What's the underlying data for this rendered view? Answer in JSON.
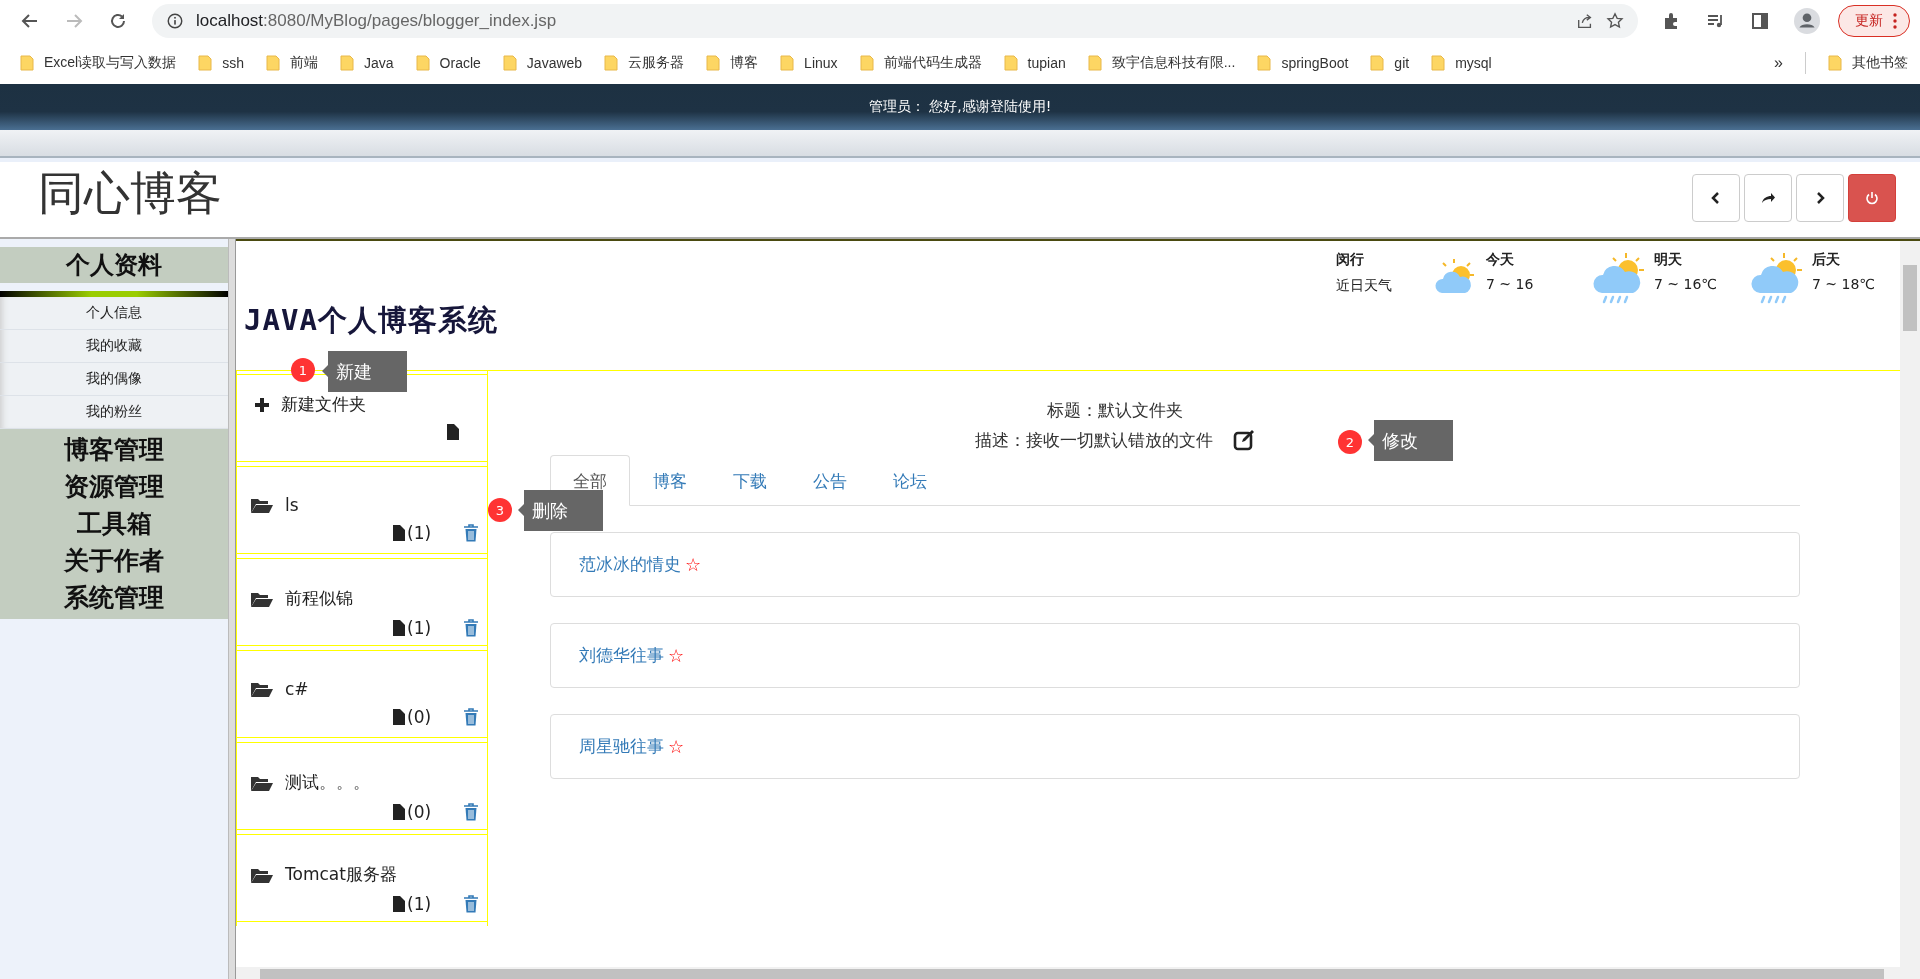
{
  "browser": {
    "url_host": "localhost",
    "url_rest": ":8080/MyBlog/pages/blogger_index.jsp",
    "update_button": "更新",
    "bookmarks": [
      "Excel读取与写入数据",
      "ssh",
      "前端",
      "Java",
      "Oracle",
      "Javaweb",
      "云服务器",
      "博客",
      "Linux",
      "前端代码生成器",
      "tupian",
      "致宇信息科技有限...",
      "springBoot",
      "git",
      "mysql"
    ],
    "more": "»",
    "other_bookmarks": "其他书签"
  },
  "banner": {
    "text": "管理员： 您好,感谢登陆使用!"
  },
  "header": {
    "title": "同心博客"
  },
  "sidebar": {
    "profile_title": "个人资料",
    "profile_items": [
      {
        "label": "个人信息"
      },
      {
        "label": "我的收藏"
      },
      {
        "label": "我的偶像"
      },
      {
        "label": "我的粉丝"
      }
    ],
    "sections": [
      {
        "label": "博客管理"
      },
      {
        "label": "资源管理"
      },
      {
        "label": "工具箱"
      },
      {
        "label": "关于作者"
      },
      {
        "label": "系统管理"
      }
    ]
  },
  "weather": {
    "place": "闵行",
    "caption": "近日天气",
    "days": [
      {
        "label": "今天",
        "range": "7 ~ 16",
        "kind": "cloudy"
      },
      {
        "label": "明天",
        "range": "7 ~ 16℃",
        "kind": "rain"
      },
      {
        "label": "后天",
        "range": "7 ~ 18℃",
        "kind": "rain"
      }
    ]
  },
  "system_title": "JAVA个人博客系统",
  "folders": [
    {
      "kind": "new",
      "label": "新建文件夹"
    },
    {
      "kind": "folder",
      "name": "ls",
      "count": "(1)"
    },
    {
      "kind": "folder",
      "name": "前程似锦",
      "count": "(1)"
    },
    {
      "kind": "folder",
      "name": "c#",
      "count": "(0)"
    },
    {
      "kind": "folder",
      "name": "测试。。。",
      "count": "(0)"
    },
    {
      "kind": "folder",
      "name": "Tomcat服务器",
      "count": "(1)"
    }
  ],
  "detail": {
    "title": "标题：默认文件夹",
    "description": "描述：接收一切默认错放的文件"
  },
  "tabs": [
    {
      "label": "全部",
      "selected": true
    },
    {
      "label": "博客",
      "selected": false
    },
    {
      "label": "下载",
      "selected": false
    },
    {
      "label": "公告",
      "selected": false
    },
    {
      "label": "论坛",
      "selected": false
    }
  ],
  "posts": [
    {
      "title": "范冰冰的情史",
      "mark": "☆"
    },
    {
      "title": "刘德华往事",
      "mark": "☆"
    },
    {
      "title": "周星驰往事",
      "mark": "☆"
    }
  ],
  "tooltips": [
    {
      "number": "1",
      "text": "新建"
    },
    {
      "number": "2",
      "text": "修改"
    },
    {
      "number": "3",
      "text": "删除"
    }
  ]
}
